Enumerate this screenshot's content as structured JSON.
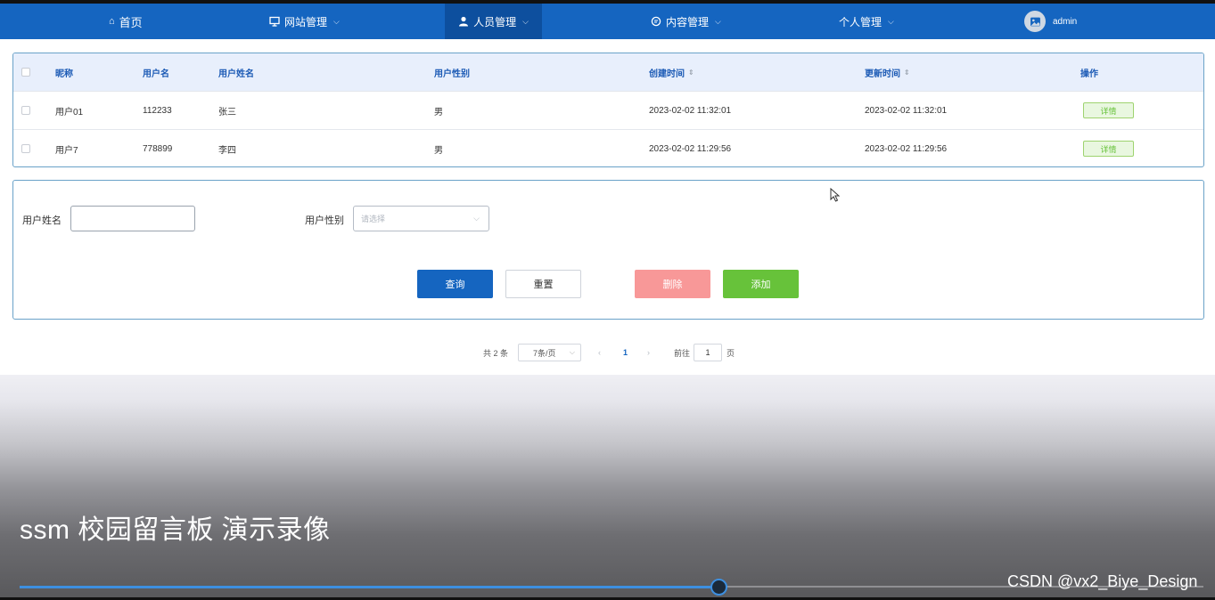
{
  "nav": {
    "home": "首页",
    "site_mgmt": "网站管理",
    "people_mgmt": "人员管理",
    "content_mgmt": "内容管理",
    "personal_mgmt": "个人管理",
    "username": "admin"
  },
  "table": {
    "headers": {
      "nickname": "昵称",
      "username": "用户名",
      "realname": "用户姓名",
      "gender": "用户性别",
      "created": "创建时间",
      "updated": "更新时间",
      "action": "操作"
    },
    "rows": [
      {
        "nickname": "用户01",
        "username": "112233",
        "realname": "张三",
        "gender": "男",
        "created": "2023-02-02 11:32:01",
        "updated": "2023-02-02 11:32:01",
        "action": "详情"
      },
      {
        "nickname": "用户7",
        "username": "778899",
        "realname": "李四",
        "gender": "男",
        "created": "2023-02-02 11:29:56",
        "updated": "2023-02-02 11:29:56",
        "action": "详情"
      }
    ]
  },
  "search": {
    "name_label": "用户姓名",
    "name_value": "",
    "gender_label": "用户性别",
    "gender_placeholder": "请选择",
    "query": "查询",
    "reset": "重置",
    "delete": "删除",
    "add": "添加",
    "colors": {
      "query": "#1565c0",
      "delete": "#f89898",
      "add": "#67c23a"
    }
  },
  "pager": {
    "total": "共 2 条",
    "page_size": "7条/页",
    "current": "1",
    "goto_label": "前往",
    "goto_value": "1",
    "page_unit": "页"
  },
  "video": {
    "caption": "ssm 校园留言板 演示录像",
    "watermark": "CSDN @vx2_Biye_Design",
    "progress": 0.59
  }
}
